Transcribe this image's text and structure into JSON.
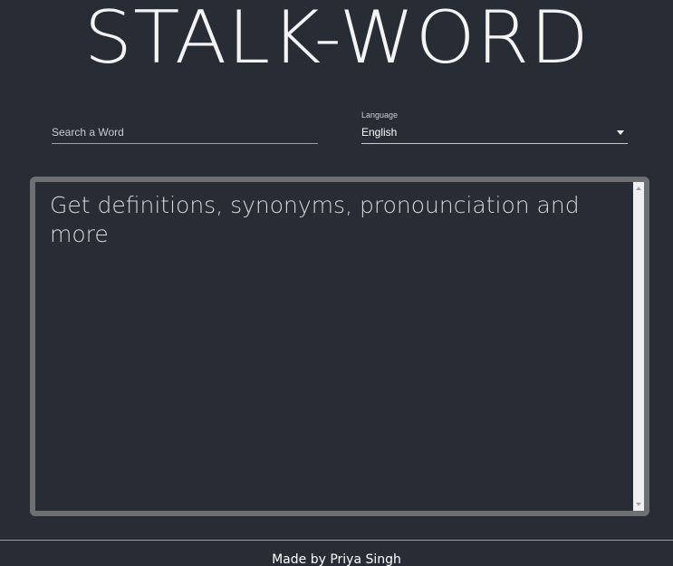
{
  "app": {
    "title": "STALK-WORD"
  },
  "search": {
    "placeholder": "Search a Word",
    "value": ""
  },
  "language": {
    "label": "Language",
    "selected": "English",
    "caret_icon": "caret-down-icon"
  },
  "result": {
    "text": "Get definitions, synonyms, pronounciation and more"
  },
  "footer": {
    "text": "Made by Priya Singh"
  },
  "colors": {
    "background": "#282c34",
    "box_border": "#6d6f72",
    "text": "#ffffff"
  }
}
